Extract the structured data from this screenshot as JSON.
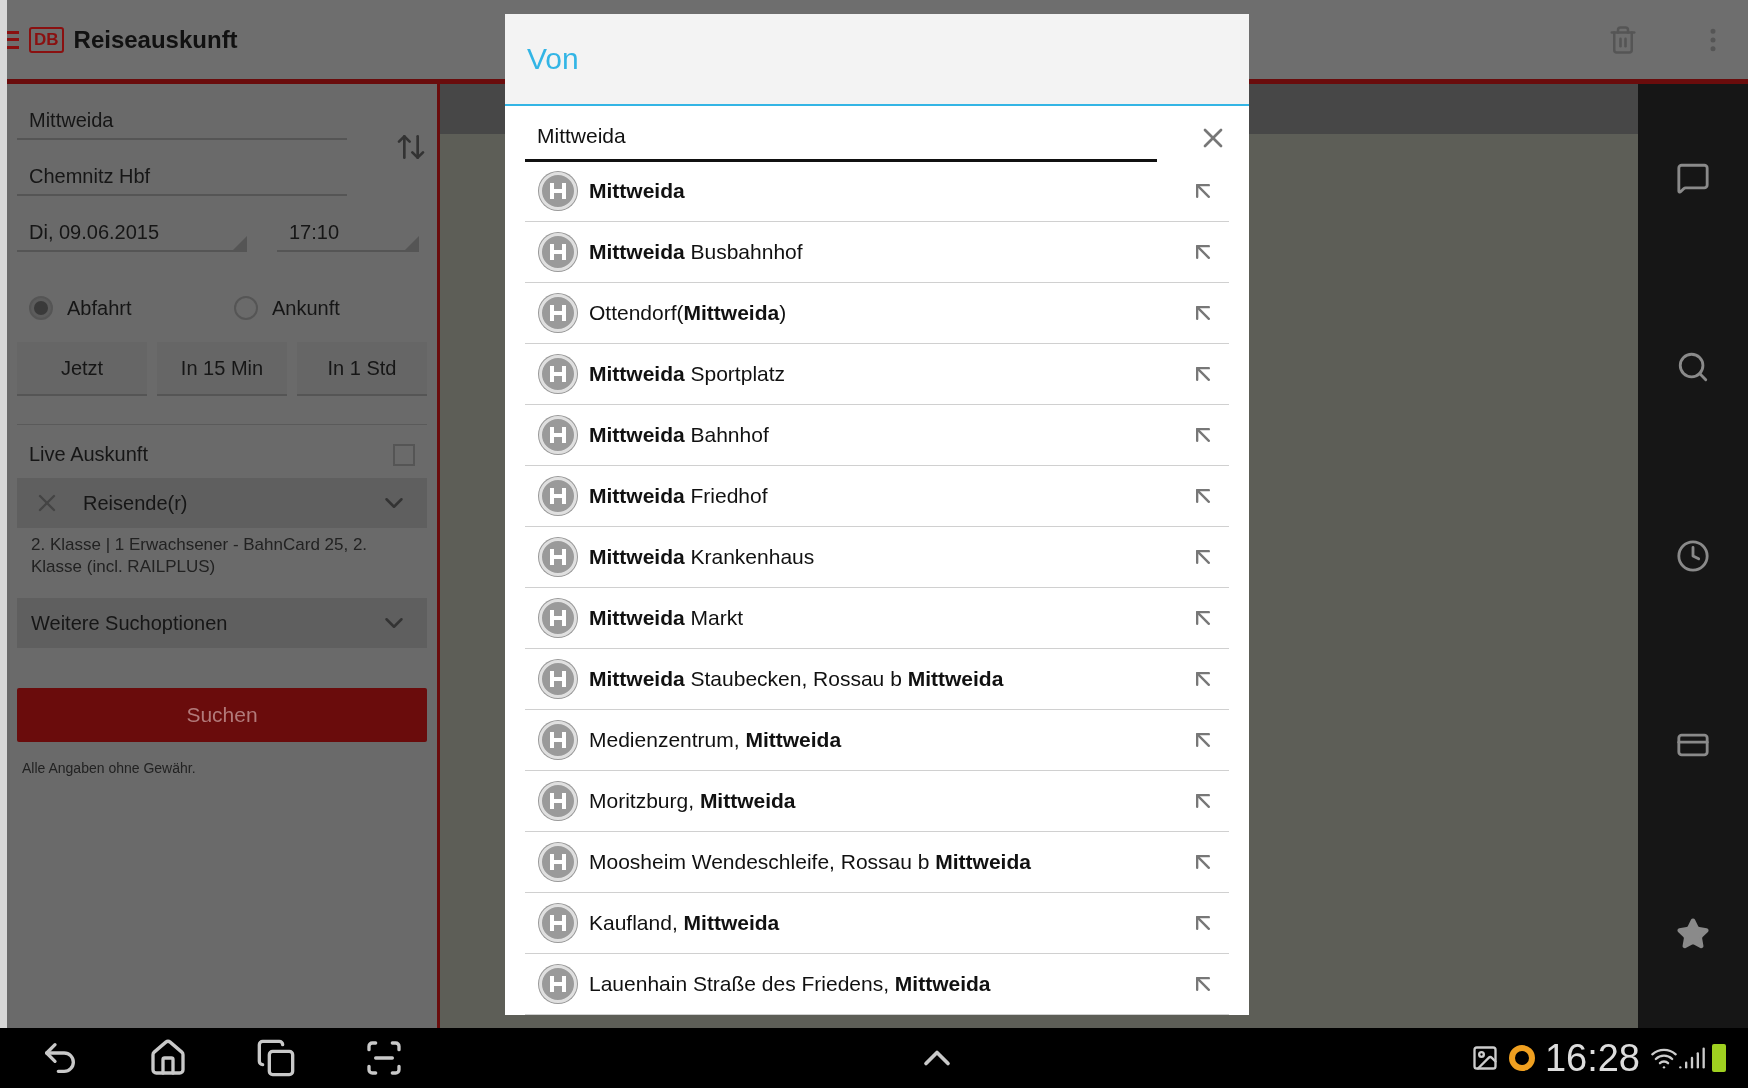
{
  "app_bar": {
    "logo": "DB",
    "title": "Reiseauskunft"
  },
  "form": {
    "from": "Mittweida",
    "to": "Chemnitz Hbf",
    "date": "Di, 09.06.2015",
    "time": "17:10",
    "modes": [
      {
        "label": "Abfahrt",
        "selected": true
      },
      {
        "label": "Ankunft",
        "selected": false
      }
    ],
    "quick_buttons": [
      "Jetzt",
      "In 15 Min",
      "In 1 Std"
    ],
    "live": {
      "label": "Live Auskunft",
      "checked": false
    },
    "travellers": {
      "label": "Reisende(r)",
      "summary": "2. Klasse | 1 Erwachsener - BahnCard 25, 2. Klasse (incl. RAILPLUS)"
    },
    "more_options": "Weitere Suchoptionen",
    "search_button": "Suchen",
    "disclaimer": "Alle Angaben ohne Gewähr."
  },
  "dialog": {
    "title": "Von",
    "query": "Mittweida",
    "suggestions": [
      "**Mittweida**",
      "**Mittweida** Busbahnhof",
      "Ottendorf(**Mittweida**)",
      "**Mittweida** Sportplatz",
      "**Mittweida** Bahnhof",
      "**Mittweida** Friedhof",
      "**Mittweida** Krankenhaus",
      "**Mittweida** Markt",
      "**Mittweida** Staubecken, Rossau b **Mittweida**",
      "Medienzentrum, **Mittweida**",
      "Moritzburg, **Mittweida**",
      "Moosheim Wendeschleife, Rossau b **Mittweida**",
      "Kaufland, **Mittweida**",
      "Lauenhain Straße des Friedens, **Mittweida**"
    ]
  },
  "status_bar": {
    "time": "16:28"
  }
}
